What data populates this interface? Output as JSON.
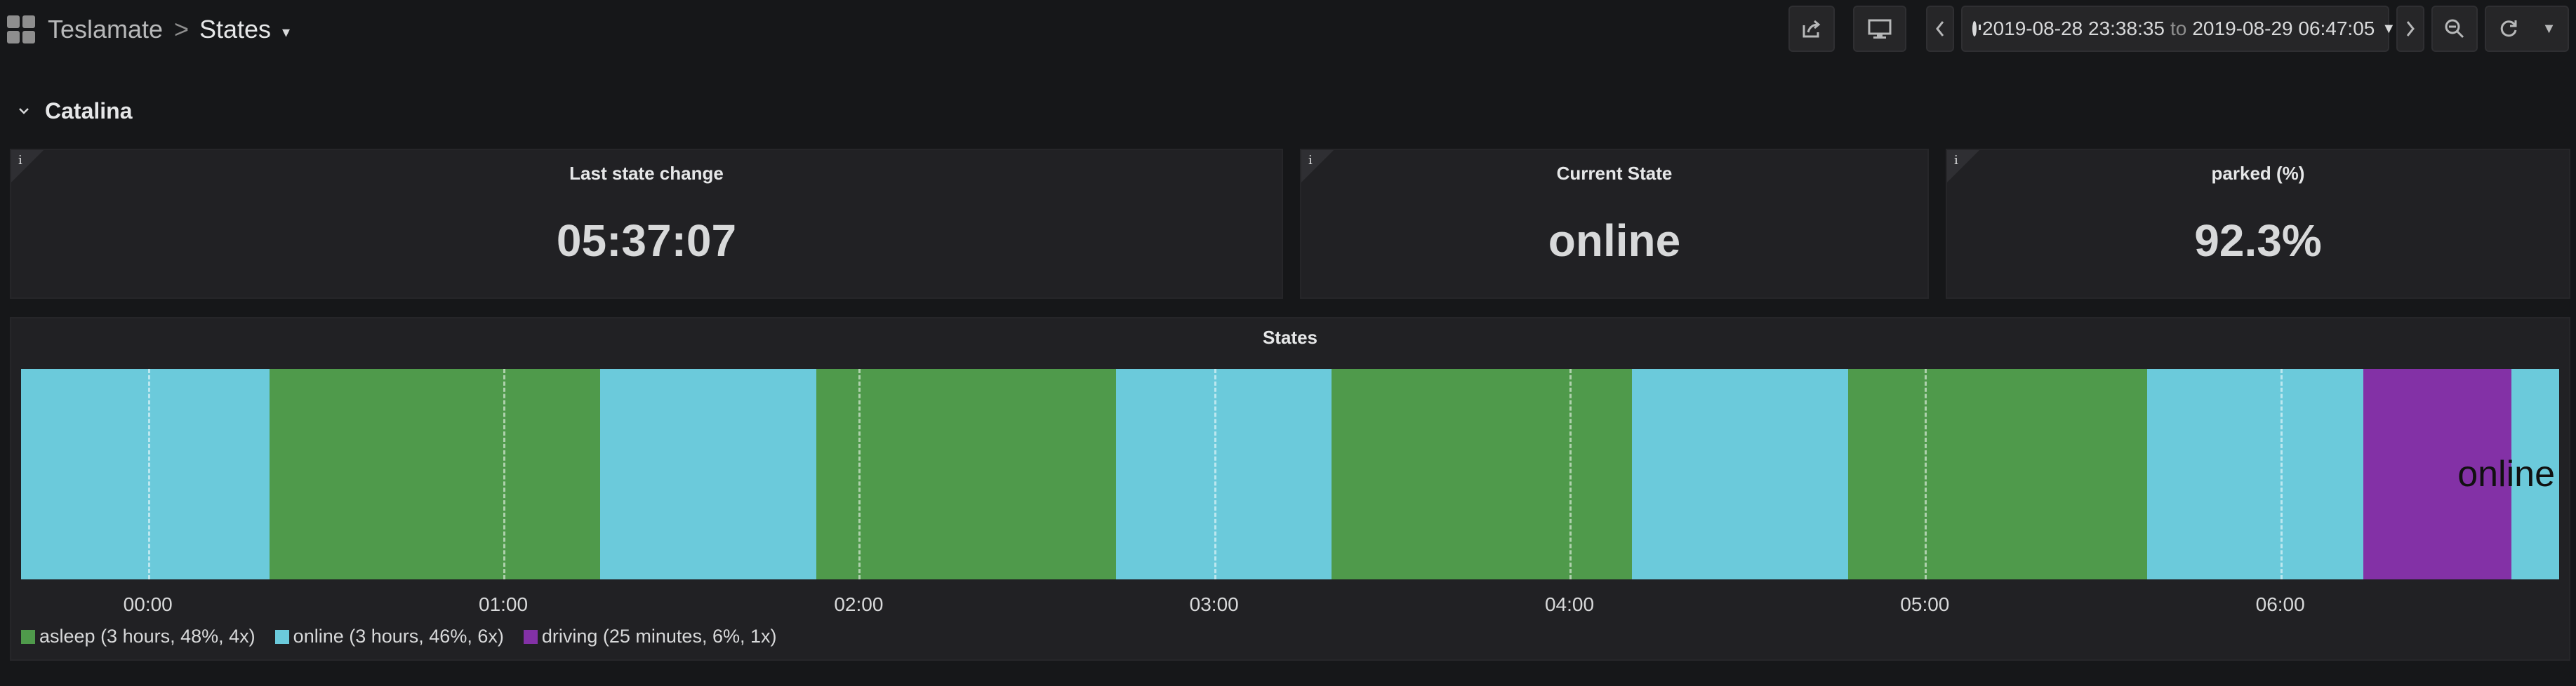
{
  "navbar": {
    "breadcrumb_parent": "Teslamate",
    "breadcrumb_separator": ">",
    "breadcrumb_current": "States",
    "time_range_from": "2019-08-28 23:38:35",
    "time_range_to_word": "to",
    "time_range_to": "2019-08-29 06:47:05"
  },
  "row": {
    "title": "Catalina"
  },
  "stats": {
    "last_state_change": {
      "title": "Last state change",
      "value": "05:37:07"
    },
    "current_state": {
      "title": "Current State",
      "value": "online"
    },
    "parked": {
      "title": "parked (%)",
      "value": "92.3%"
    }
  },
  "chart_data": {
    "type": "state-timeline",
    "title": "States",
    "x_range": [
      "23:38:35",
      "06:47:05"
    ],
    "tick_labels": [
      "00:00",
      "01:00",
      "02:00",
      "03:00",
      "04:00",
      "05:00",
      "06:00"
    ],
    "current_value_label": "online",
    "states": {
      "asleep": {
        "color": "#4f9a4b"
      },
      "online": {
        "color": "#6bcadb"
      },
      "driving": {
        "color": "#8331a6"
      }
    },
    "segments": [
      {
        "state": "online",
        "start": "23:38:35",
        "end": "00:20:30"
      },
      {
        "state": "asleep",
        "start": "00:20:30",
        "end": "01:16:20"
      },
      {
        "state": "online",
        "start": "01:16:20",
        "end": "01:52:50"
      },
      {
        "state": "asleep",
        "start": "01:52:50",
        "end": "02:43:30"
      },
      {
        "state": "online",
        "start": "02:43:30",
        "end": "03:19:50"
      },
      {
        "state": "asleep",
        "start": "03:19:50",
        "end": "04:10:30"
      },
      {
        "state": "online",
        "start": "04:10:30",
        "end": "04:47:00"
      },
      {
        "state": "asleep",
        "start": "04:47:00",
        "end": "05:37:30"
      },
      {
        "state": "online",
        "start": "05:37:30",
        "end": "06:14:00"
      },
      {
        "state": "driving",
        "start": "06:14:00",
        "end": "06:39:00"
      },
      {
        "state": "online",
        "start": "06:39:00",
        "end": "06:47:05"
      }
    ],
    "legend": [
      {
        "state": "asleep",
        "label": "asleep (3 hours, 48%, 4x)",
        "color": "#4f9a4b"
      },
      {
        "state": "online",
        "label": "online (3 hours, 46%, 6x)",
        "color": "#6bcadb"
      },
      {
        "state": "driving",
        "label": "driving (25 minutes, 6%, 1x)",
        "color": "#8331a6"
      }
    ]
  }
}
